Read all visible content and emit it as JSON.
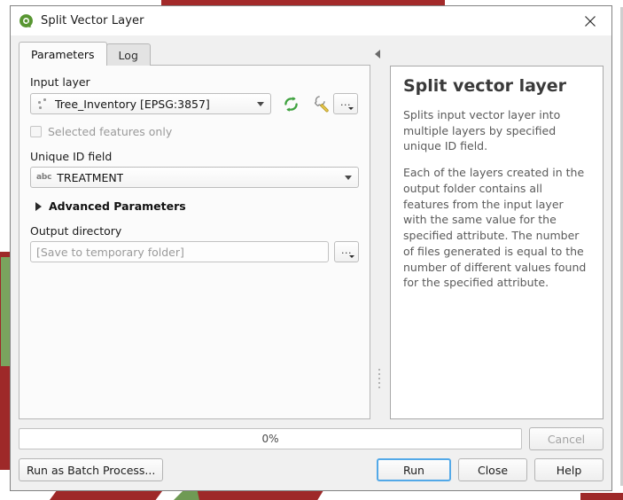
{
  "window": {
    "title": "Split Vector Layer",
    "logo_icon": "qgis-logo-icon",
    "close_icon": "close-icon"
  },
  "tabs": [
    {
      "label": "Parameters",
      "active": true
    },
    {
      "label": "Log",
      "active": false
    }
  ],
  "parameters": {
    "input_layer": {
      "label": "Input layer",
      "value": "Tree_Inventory [EPSG:3857]",
      "layer_icon": "point-layer-icon",
      "dropdown_icon": "chevron-down-icon",
      "iterate_icon": "iterate-refresh-icon",
      "advanced_options_icon": "wrench-icon",
      "browse_label": "...",
      "browse_icon": "ellipsis-dropdown-icon"
    },
    "selected_features_only": {
      "label": "Selected features only",
      "checked": false,
      "enabled": false
    },
    "unique_id_field": {
      "label": "Unique ID field",
      "value": "TREATMENT",
      "type_icon": "abc-string-field-icon",
      "type_icon_text": "abc",
      "dropdown_icon": "chevron-down-icon"
    },
    "advanced_parameters": {
      "label": "Advanced Parameters",
      "expanded": false,
      "arrow_icon": "triangle-right-icon"
    },
    "output_directory": {
      "label": "Output directory",
      "value": "",
      "placeholder": "[Save to temporary folder]",
      "browse_label": "...",
      "browse_icon": "ellipsis-dropdown-icon"
    }
  },
  "splitter": {
    "collapse_icon": "collapse-left-arrow-icon",
    "grip_icon": "splitter-grip-icon"
  },
  "help": {
    "title": "Split vector layer",
    "paragraphs": [
      "Splits input vector layer into multiple layers by specified unique ID field.",
      "Each of the layers created in the output folder contains all features from the input layer with the same value for the specified attribute. The number of files generated is equal to the number of different values found for the specified attribute."
    ]
  },
  "footer": {
    "progress_text": "0%",
    "progress_percent": 0,
    "cancel_label": "Cancel",
    "cancel_enabled": false,
    "batch_label": "Run as Batch Process...",
    "run_label": "Run",
    "close_label": "Close",
    "help_label": "Help"
  },
  "colors": {
    "accent_default_button": "#53a9e8",
    "qgis_green": "#589632",
    "iterate_icon_green": "#3fa23f",
    "wrench_yellow": "#e8c84a",
    "backdrop_red": "#9e2929",
    "backdrop_green": "#7aa45e",
    "dialog_bg": "#f0f0f0",
    "panel_bg": "#fbfbfb"
  }
}
